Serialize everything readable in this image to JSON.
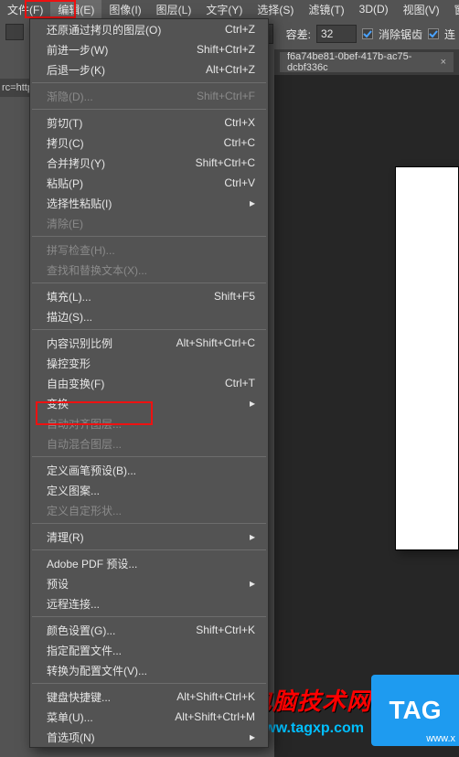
{
  "menubar": {
    "file": "文件(F)",
    "edit": "编辑(E)",
    "image": "图像(I)",
    "layer": "图层(L)",
    "type": "文字(Y)",
    "select": "选择(S)",
    "filter": "滤镜(T)",
    "threeD": "3D(D)",
    "view": "视图(V)",
    "window": "窗口"
  },
  "optionsbar": {
    "tolerance_label": "容差:",
    "tolerance_value": "32",
    "antialias_label": "消除锯齿",
    "contig_label": "连"
  },
  "tab": {
    "title": "f6a74be81-0bef-417b-ac75-dcbf336c",
    "close": "×"
  },
  "left": {
    "src_hint": "rc=http"
  },
  "menu": {
    "undo_via_copy": {
      "label": "还原通过拷贝的图层(O)",
      "accel": "Ctrl+Z"
    },
    "step_forward": {
      "label": "前进一步(W)",
      "accel": "Shift+Ctrl+Z"
    },
    "step_backward": {
      "label": "后退一步(K)",
      "accel": "Alt+Ctrl+Z"
    },
    "fade": {
      "label": "渐隐(D)...",
      "accel": "Shift+Ctrl+F"
    },
    "cut": {
      "label": "剪切(T)",
      "accel": "Ctrl+X"
    },
    "copy": {
      "label": "拷贝(C)",
      "accel": "Ctrl+C"
    },
    "copy_merged": {
      "label": "合并拷贝(Y)",
      "accel": "Shift+Ctrl+C"
    },
    "paste": {
      "label": "粘贴(P)",
      "accel": "Ctrl+V"
    },
    "paste_special": {
      "label": "选择性粘贴(I)"
    },
    "clear": {
      "label": "清除(E)"
    },
    "spell": {
      "label": "拼写检查(H)..."
    },
    "find_replace": {
      "label": "查找和替换文本(X)..."
    },
    "fill": {
      "label": "填充(L)...",
      "accel": "Shift+F5"
    },
    "stroke": {
      "label": "描边(S)..."
    },
    "content_scale": {
      "label": "内容识别比例",
      "accel": "Alt+Shift+Ctrl+C"
    },
    "puppet_warp": {
      "label": "操控变形"
    },
    "free_transform": {
      "label": "自由变换(F)",
      "accel": "Ctrl+T"
    },
    "transform": {
      "label": "变换"
    },
    "auto_align": {
      "label": "自动对齐图层..."
    },
    "auto_blend": {
      "label": "自动混合图层..."
    },
    "define_brush": {
      "label": "定义画笔预设(B)..."
    },
    "define_pattern": {
      "label": "定义图案..."
    },
    "define_shape": {
      "label": "定义自定形状..."
    },
    "purge": {
      "label": "清理(R)"
    },
    "adobe_pdf": {
      "label": "Adobe PDF 预设..."
    },
    "presets": {
      "label": "预设"
    },
    "remote_conn": {
      "label": "远程连接..."
    },
    "color_settings": {
      "label": "颜色设置(G)...",
      "accel": "Shift+Ctrl+K"
    },
    "assign_profile": {
      "label": "指定配置文件..."
    },
    "convert_profile": {
      "label": "转换为配置文件(V)..."
    },
    "kbd_shortcuts": {
      "label": "键盘快捷键...",
      "accel": "Alt+Shift+Ctrl+K"
    },
    "menus": {
      "label": "菜单(U)...",
      "accel": "Alt+Shift+Ctrl+M"
    },
    "preferences": {
      "label": "首选项(N)"
    }
  },
  "watermark": {
    "title": "电脑技术网",
    "url": "www.tagxp.com",
    "tag": "TAG",
    "tag_sub": "www.x"
  }
}
